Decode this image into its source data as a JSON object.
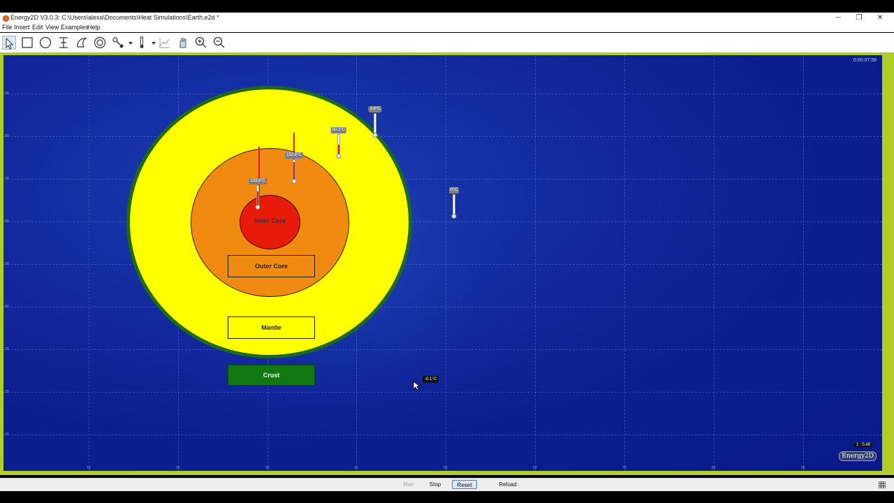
{
  "window": {
    "title": "Energy2D V3.0.3: C:\\Users\\alexa\\Documents\\Heat Simulations\\Earth.e2d *",
    "minimize": "─",
    "maximize": "❐",
    "close": "✕"
  },
  "menu": [
    "File",
    "Insert",
    "Edit",
    "View",
    "Examples",
    "Help"
  ],
  "toolbar": {
    "tools": [
      "select-arrow-icon",
      "rectangle-icon",
      "ellipse-icon",
      "text-cursor-icon",
      "blob-icon",
      "annulus-icon",
      "heater-icon",
      "thermometer-icon",
      "graph-icon",
      "hand-icon",
      "zoom-in-icon",
      "zoom-out-icon"
    ]
  },
  "simulation": {
    "timer": "0:00:07:58",
    "y_ticks": [
      "90",
      "80",
      "70",
      "60",
      "50",
      "40",
      "30",
      "20",
      "10"
    ],
    "x_ticks": [
      "10",
      "20",
      "30",
      "40",
      "50",
      "60",
      "70",
      "80",
      "90"
    ],
    "parts": {
      "inner_core": "Inner Core",
      "outer_core": "Outer Core",
      "mantle": "Mantle",
      "crust": "Crust"
    },
    "thermometers": [
      {
        "label": "103.8°C",
        "fill_fraction": 0.7
      },
      {
        "label": "152.8°C",
        "fill_fraction": 0.9
      },
      {
        "label": "50.2°C",
        "fill_fraction": 0.5
      },
      {
        "label": "3.8°C",
        "fill_fraction": 0.05
      },
      {
        "label": "0°C",
        "fill_fraction": 0.0
      }
    ],
    "hover_temperature": "-0.1°C",
    "scale": "1 : 0.48",
    "brand": "Energy2D"
  },
  "controls": {
    "run": "Run",
    "stop": "Stop",
    "reset": "Reset",
    "reload": "Reload"
  },
  "colors": {
    "crust": "#1f6a1a",
    "mantle": "#ffff00",
    "outer_core": "#f08a10",
    "inner_core": "#e81a0a",
    "background": "#0c1e8e",
    "frame": "#b2cc2a"
  }
}
